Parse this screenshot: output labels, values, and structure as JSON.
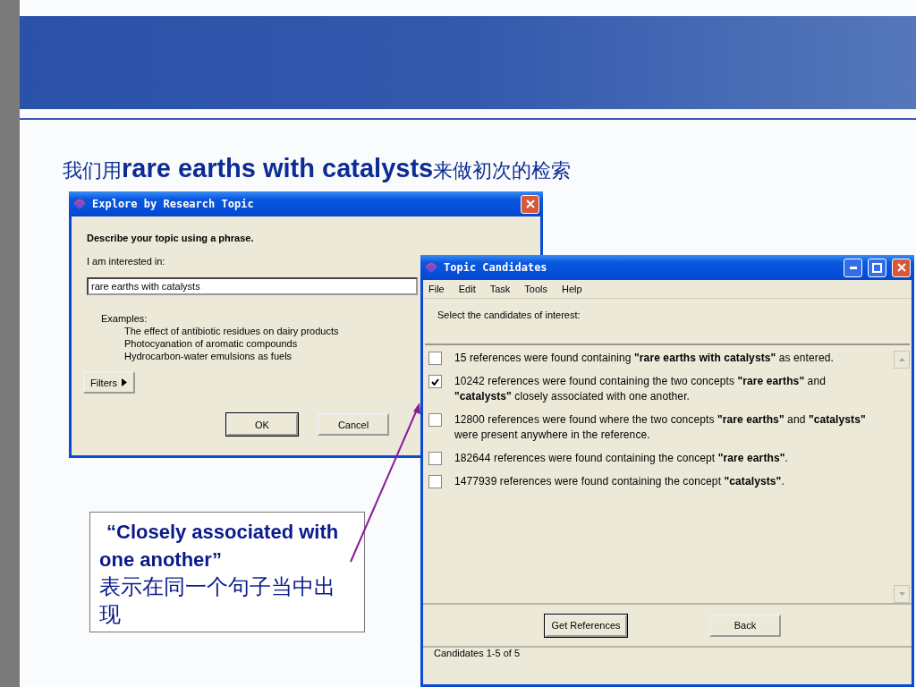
{
  "slide_title": {
    "prefix": "我们用",
    "emphasis": "rare earths with catalysts",
    "suffix": "来做初次的检索"
  },
  "explore_window": {
    "title": "Explore by Research Topic",
    "heading": "Describe your topic using a phrase.",
    "field_label": "I am interested in:",
    "field_value": "rare earths with catalysts",
    "examples_label": "Examples:",
    "examples": [
      "The effect of antibiotic residues on dairy products",
      "Photocyanation of aromatic compounds",
      "Hydrocarbon-water emulsions as fuels"
    ],
    "filters_button": "Filters",
    "buttons": [
      "OK",
      "Cancel"
    ]
  },
  "candidates_window": {
    "title": "Topic Candidates",
    "menu": [
      "File",
      "Edit",
      "Task",
      "Tools",
      "Help"
    ],
    "instruction": "Select the candidates of interest:",
    "candidates": [
      {
        "text": "15 references were found containing **\"rare earths with catalysts\"** as entered.",
        "checked": false
      },
      {
        "text": "10242 references were found containing the two concepts **\"rare earths\"** and **\"catalysts\"** closely associated with one another.",
        "checked": true
      },
      {
        "text": "12800 references were found where the two concepts **\"rare earths\"** and **\"catalysts\"** were present anywhere in the reference.",
        "checked": false
      },
      {
        "text": "182644 references were found containing the concept **\"rare earths\"**.",
        "checked": false
      },
      {
        "text": "1477939 references were found containing the concept **\"catalysts\"**.",
        "checked": false
      }
    ],
    "buttons": [
      "Get References",
      "Back"
    ],
    "status": "Candidates 1-5 of 5"
  },
  "callout": {
    "quote": "“Closely associated with one another”",
    "note": "表示在同一个句子当中出现"
  }
}
